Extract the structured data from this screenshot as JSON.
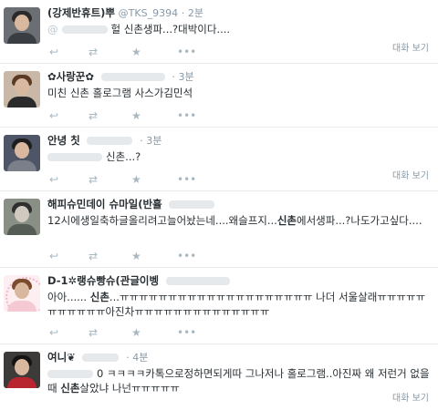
{
  "tweets": [
    {
      "name": "(강제반휴트)뿌",
      "handle": "@TKS_9394",
      "time": "2분",
      "text_pre": "@",
      "text": "헐 신촌생파...?대박이다....",
      "conversation": "대화 보기"
    },
    {
      "name": "✿사랑꾼✿",
      "handle": "",
      "time": "3분",
      "text": "미친 신촌 홀로그램 사스가김민석",
      "conversation": ""
    },
    {
      "name": "안녕 칫",
      "handle": "",
      "time": "3분",
      "text": "신촌...?",
      "conversation": "대화 보기"
    },
    {
      "name": "해피슈민데이 슈마일(반휼",
      "handle": "",
      "time": "",
      "text_a": "12시에생일축하글올리려고늘어놨는네....왜슬프지...",
      "text_hl": "신촌",
      "text_b": "에서생파...?나도가고싶다....",
      "conversation": ""
    },
    {
      "name": "D-1✲랭슈빵슈(관글이벵",
      "handle": "",
      "time": "",
      "text_a": "아아...... ",
      "text_hl": "신촌",
      "text_b": "...ㅠㅠㅠㅠㅠㅠㅠㅠㅠㅠㅠㅠㅠㅠㅠㅠㅠㅠㅠㅠ 나더 서울살래ㅠㅠㅠㅠㅠㅠㅠㅠㅠㅠㅠ아진차ㅠㅠㅠㅠㅠㅠㅠㅠㅠㅠㅠㅠㅠㅠ",
      "conversation": ""
    },
    {
      "name": "여니❦",
      "handle": "",
      "time": "4분",
      "text_a": "0 ㅋㅋㅋㅋ카톡으로정하면되게따 그나저나 홀로그램..아진짜 왜 저런거 없을때 ",
      "text_hl": "신촌",
      "text_b": "살았냐 나넌ㅠㅠㅠㅠㅠ",
      "conversation": "대화 보기"
    }
  ],
  "actions": {
    "reply": "↩",
    "retweet": "⇄",
    "favorite": "★",
    "more": "•••"
  }
}
